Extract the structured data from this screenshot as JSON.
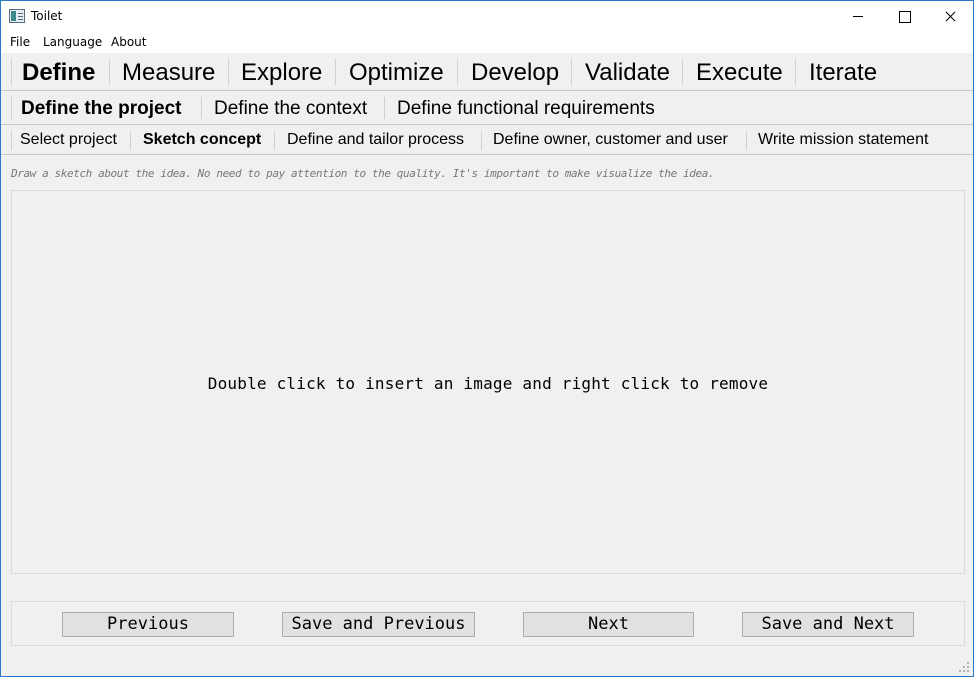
{
  "window": {
    "title": "Toilet"
  },
  "menu": {
    "items": [
      "File",
      "Language",
      "About"
    ]
  },
  "phases": {
    "items": [
      "Define",
      "Measure",
      "Explore",
      "Optimize",
      "Develop",
      "Validate",
      "Execute",
      "Iterate"
    ],
    "active": "Define"
  },
  "subphases": {
    "items": [
      "Define the project",
      "Define the context",
      "Define functional requirements"
    ],
    "active": "Define the project"
  },
  "steps": {
    "items": [
      "Select project",
      "Sketch concept",
      "Define and tailor process",
      "Define owner, customer and user",
      "Write mission statement"
    ],
    "active": "Sketch concept"
  },
  "hint": "Draw a sketch about the idea. No need to pay attention to the quality. It's important to make visualize the idea.",
  "image_area": {
    "placeholder": "Double click to insert an image and right click to remove"
  },
  "navigation": {
    "previous": "Previous",
    "save_previous": "Save and Previous",
    "next": "Next",
    "save_next": "Save and Next"
  }
}
